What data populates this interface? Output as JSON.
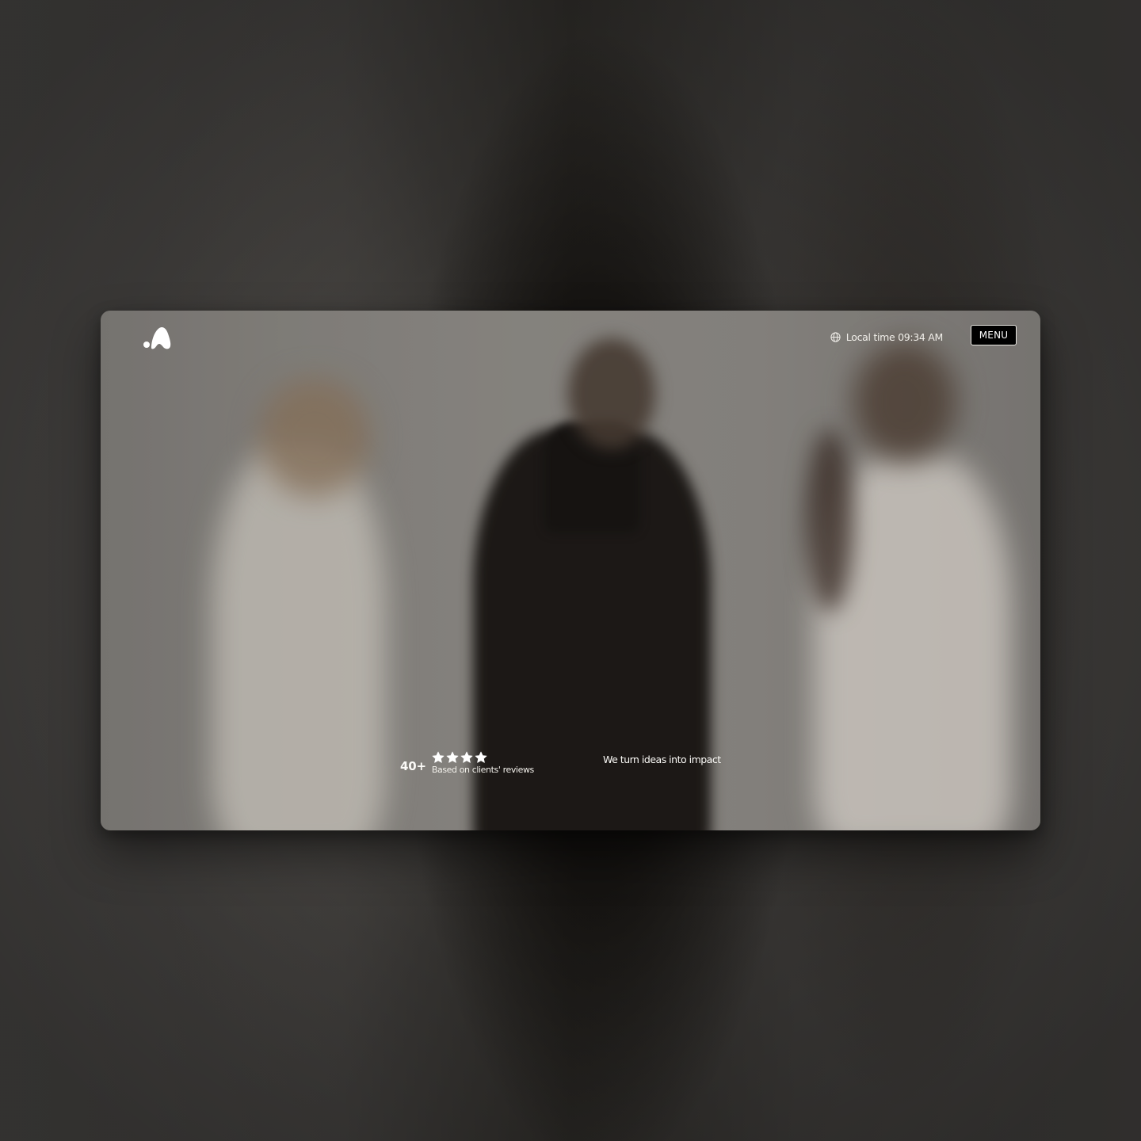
{
  "header": {
    "logo_icon": "brand-logo-icon",
    "local_time_label": "Local time 09:34 AM",
    "globe_icon": "globe-icon",
    "menu_label": "MENU"
  },
  "hero": {
    "rating_count": "40+",
    "rating_stars": 4,
    "rating_caption": "Based on clients' reviews",
    "tagline": "We turn ideas into impact"
  },
  "colors": {
    "text": "#fbfaf7",
    "menu_bg": "#000000",
    "menu_border": "#e8e6e1"
  }
}
